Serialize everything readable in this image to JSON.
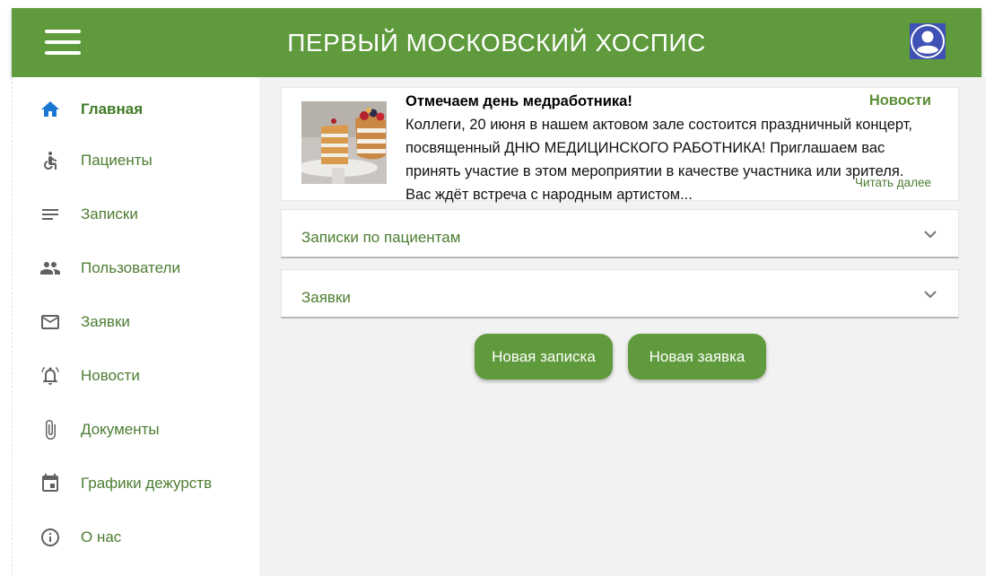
{
  "header": {
    "title": "ПЕРВЫЙ МОСКОВСКИЙ ХОСПИС",
    "menu_icon": "hamburger-menu-icon",
    "avatar_icon": "user-avatar-icon",
    "color": "#5f9a3c"
  },
  "sidebar": {
    "items": [
      {
        "label": "Главная",
        "icon": "home-icon",
        "active": true
      },
      {
        "label": "Пациенты",
        "icon": "accessible-icon"
      },
      {
        "label": "Записки",
        "icon": "notes-lines-icon"
      },
      {
        "label": "Пользователи",
        "icon": "people-icon"
      },
      {
        "label": "Заявки",
        "icon": "mail-icon"
      },
      {
        "label": "Новости",
        "icon": "alarm-bell-icon"
      },
      {
        "label": "Документы",
        "icon": "paperclip-icon"
      },
      {
        "label": "Графики дежурств",
        "icon": "calendar-icon"
      },
      {
        "label": "О нас",
        "icon": "info-icon"
      }
    ]
  },
  "news": {
    "title": "Отмечаем день медработника!",
    "category": "Новости",
    "text_lines": [
      "Коллеги, 20 июня в нашем актовом зале состоится праздничный концерт,",
      "посвященный ДНЮ МЕДИЦИНСКОГО РАБОТНИКА! Приглашаем вас",
      "принять участие в этом мероприятии в качестве участника или зрителя.",
      "Вас ждёт встреча с народным артистом..."
    ],
    "read_more": "Читать далее",
    "image_icon": "cake-image"
  },
  "accordions": [
    {
      "label": "Записки по пациентам",
      "icon": "chevron-down-icon"
    },
    {
      "label": "Заявки",
      "icon": "chevron-down-icon"
    }
  ],
  "buttons": {
    "new_note": "Новая записка",
    "new_request": "Новая заявка"
  },
  "colors": {
    "accent": "#5f9a3c",
    "link": "#4c7d31",
    "home_icon": "#1976d2",
    "icon_gray": "#616161"
  }
}
